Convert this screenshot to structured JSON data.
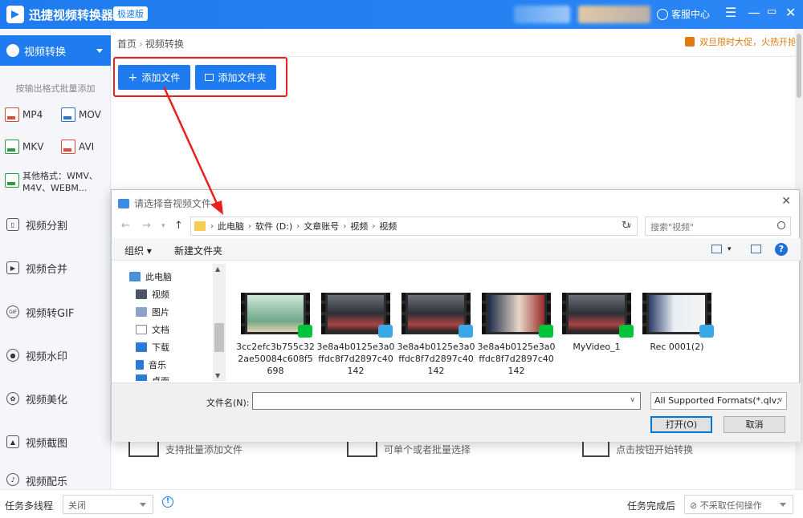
{
  "titlebar": {
    "app_title": "迅捷视频转换器",
    "edition": "极速版",
    "support": "客服中心"
  },
  "sidebar": {
    "active": "视频转换",
    "batch_hint": "按输出格式批量添加",
    "formats": [
      "MP4",
      "MOV",
      "MKV",
      "AVI"
    ],
    "other_formats_line1": "其他格式：WMV、",
    "other_formats_line2": "M4V、WEBM...",
    "items": [
      "视频分割",
      "视频合并",
      "视频转GIF",
      "视频水印",
      "视频美化",
      "视频截图",
      "视频配乐"
    ]
  },
  "main": {
    "breadcrumb_home": "首页",
    "breadcrumb_current": "视频转换",
    "promo": "双旦限时大促，火热开抢",
    "add_file": "添加文件",
    "add_folder": "添加文件夹",
    "steps": [
      "支持批量添加文件",
      "可单个或者批量选择",
      "点击按钮开始转换"
    ]
  },
  "bottom": {
    "multithread_label": "任务多线程",
    "multithread_value": "关闭",
    "after_done_label": "任务完成后",
    "after_done_value": "不采取任何操作"
  },
  "dialog": {
    "title": "请选择音视频文件",
    "path": [
      "此电脑",
      "软件 (D:)",
      "文章账号",
      "视频",
      "视频"
    ],
    "search_placeholder": "搜索\"视频\"",
    "organize": "组织",
    "new_folder": "新建文件夹",
    "tree": [
      "此电脑",
      "视频",
      "图片",
      "文档",
      "下载",
      "音乐",
      "桌面"
    ],
    "files": [
      {
        "name": "3cc2efc3b755c322ae50084c608f5698",
        "badge": "iqiyi"
      },
      {
        "name": "3e8a4b0125e3a0ffdc8f7d2897c40142",
        "badge": "play"
      },
      {
        "name": "3e8a4b0125e3a0ffdc8f7d2897c40142",
        "badge": "play"
      },
      {
        "name": "3e8a4b0125e3a0ffdc8f7d2897c40142",
        "badge": "iqiyi"
      },
      {
        "name": "MyVideo_1",
        "badge": "iqiyi"
      },
      {
        "name": "Rec 0001(2)",
        "badge": "play"
      }
    ],
    "filename_label": "文件名(N):",
    "filename_value": "",
    "format_filter": "All Supported Formats(*.qlv;",
    "open": "打开(O)",
    "cancel": "取消"
  },
  "colors": {
    "brand": "#1e7cf0",
    "highlight": "#e8201e",
    "promo": "#e07a10"
  }
}
